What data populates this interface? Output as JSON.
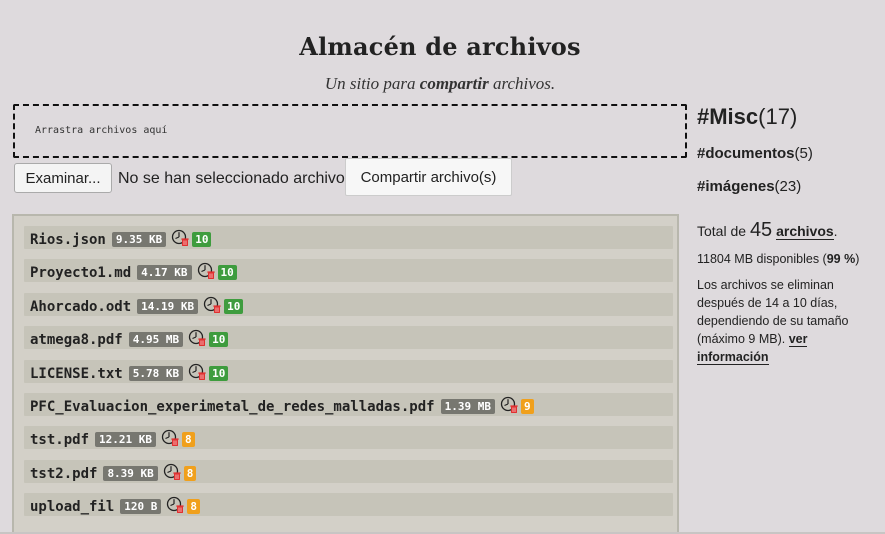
{
  "header": {
    "title": "Almacén de archivos",
    "subtitle_pre": "Un sitio para ",
    "subtitle_bold": "compartir",
    "subtitle_post": " archivos."
  },
  "dropzone": {
    "text": "Arrastra archivos aquí"
  },
  "upload": {
    "browse_label": "Examinar...",
    "no_file_text": "No se han seleccionado archivos.",
    "share_label": "Compartir archivo(s)"
  },
  "files": [
    {
      "name": "Rios.json",
      "size": "9.35 KB",
      "days": "10",
      "days_color": "#3e9c3e"
    },
    {
      "name": "Proyecto1.md",
      "size": "4.17 KB",
      "days": "10",
      "days_color": "#3e9c3e"
    },
    {
      "name": "Ahorcado.odt",
      "size": "14.19 KB",
      "days": "10",
      "days_color": "#3e9c3e"
    },
    {
      "name": "atmega8.pdf",
      "size": "4.95 MB",
      "days": "10",
      "days_color": "#3e9c3e"
    },
    {
      "name": "LICENSE.txt",
      "size": "5.78 KB",
      "days": "10",
      "days_color": "#3e9c3e"
    },
    {
      "name": "PFC_Evaluacion_experimetal_de_redes_malladas.pdf",
      "size": "1.39 MB",
      "days": "9",
      "days_color": "#f0a01c"
    },
    {
      "name": "tst.pdf",
      "size": "12.21 KB",
      "days": "8",
      "days_color": "#f0a01c"
    },
    {
      "name": "tst2.pdf",
      "size": "8.39 KB",
      "days": "8",
      "days_color": "#f0a01c"
    },
    {
      "name": "upload_fil",
      "size": "120 B",
      "days": "8",
      "days_color": "#f0a01c"
    }
  ],
  "icons": {
    "expiry": "timer-delete-icon"
  },
  "sidebar": {
    "tags": [
      {
        "name": "#Misc",
        "count": "(17)"
      },
      {
        "name": "#documentos",
        "count": "(5)"
      },
      {
        "name": "#imágenes",
        "count": "(23)"
      }
    ],
    "total_pre": "Total de ",
    "total_count": "45",
    "total_link": "archivos",
    "total_post": ".",
    "available_pre": "11804 MB disponibles (",
    "available_pct": "99 %",
    "available_post": ")",
    "info_text": "Los archivos se eliminan después de 14 a 10 días, dependiendo de su tamaño (máximo 9 MB). ",
    "info_link": "ver información"
  }
}
